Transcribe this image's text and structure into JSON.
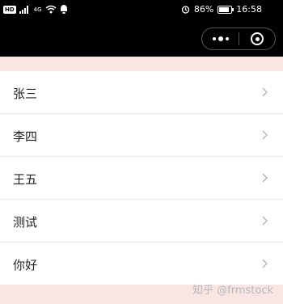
{
  "status_bar": {
    "left_badge": "HD",
    "signal_label": "4G",
    "battery_percent": "86%",
    "time": "16:58",
    "battery_level": 0.86
  },
  "nav": {
    "more_icon": "more-dots-icon",
    "close_icon": "target-close-icon"
  },
  "list": {
    "items": [
      {
        "label": "张三"
      },
      {
        "label": "李四"
      },
      {
        "label": "王五"
      },
      {
        "label": "测试"
      },
      {
        "label": "你好"
      }
    ]
  },
  "watermark": "知乎 @frmstock",
  "colors": {
    "band": "#f9e6e4",
    "divider": "#ececec",
    "chevron": "#b0b0b0"
  }
}
